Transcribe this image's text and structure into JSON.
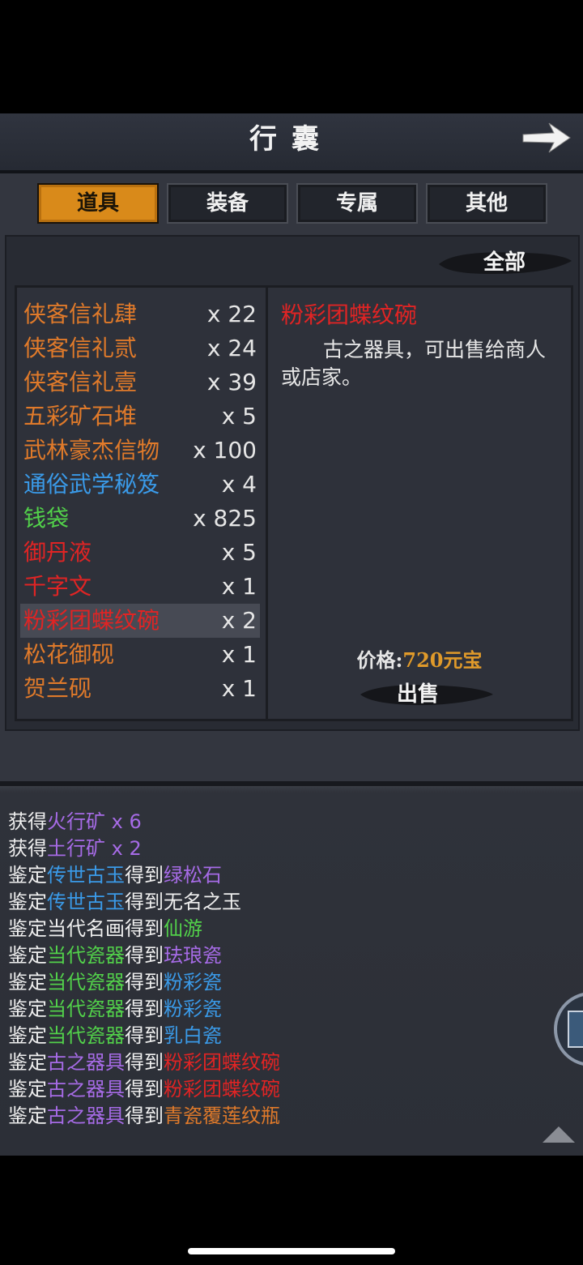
{
  "header": {
    "title": "行囊",
    "back_icon": "right-arrow-icon"
  },
  "tabs": [
    {
      "label": "道具",
      "active": true
    },
    {
      "label": "装备",
      "active": false
    },
    {
      "label": "专属",
      "active": false
    },
    {
      "label": "其他",
      "active": false
    }
  ],
  "filter": {
    "label": "全部"
  },
  "items": [
    {
      "name": "侠客信礼肆",
      "qty": "x 22",
      "color": "#e07a2a"
    },
    {
      "name": "侠客信礼贰",
      "qty": "x 24",
      "color": "#e07a2a"
    },
    {
      "name": "侠客信礼壹",
      "qty": "x 39",
      "color": "#e07a2a"
    },
    {
      "name": "五彩矿石堆",
      "qty": "x 5",
      "color": "#e07a2a"
    },
    {
      "name": "武林豪杰信物",
      "qty": "x 100",
      "color": "#e07a2a"
    },
    {
      "name": "通俗武学秘笈",
      "qty": "x 4",
      "color": "#3a9ae8"
    },
    {
      "name": "钱袋",
      "qty": "x 825",
      "color": "#52d14a"
    },
    {
      "name": "御丹液",
      "qty": "x 5",
      "color": "#e02424"
    },
    {
      "name": "千字文",
      "qty": "x 1",
      "color": "#e02424"
    },
    {
      "name": "粉彩团蝶纹碗",
      "qty": "x 2",
      "color": "#e02424",
      "selected": true
    },
    {
      "name": "松花御砚",
      "qty": "x 1",
      "color": "#e07a2a"
    },
    {
      "name": "贺兰砚",
      "qty": "x 1",
      "color": "#e07a2a"
    }
  ],
  "detail": {
    "name": "粉彩团蝶纹碗",
    "description": "古之器具，可出售给商人或店家。",
    "price_label": "价格:",
    "price_value": "720元宝",
    "sell_label": "出售"
  },
  "colors": {
    "orange": "#e07a2a",
    "blue": "#3a9ae8",
    "green": "#52d14a",
    "red": "#e02424",
    "purple": "#a66be6",
    "white": "#efefef"
  },
  "log": [
    [
      {
        "t": "获得",
        "c": "white"
      },
      {
        "t": "火行矿 x 6",
        "c": "purple"
      }
    ],
    [
      {
        "t": "获得",
        "c": "white"
      },
      {
        "t": "土行矿 x 2",
        "c": "purple"
      }
    ],
    [
      {
        "t": "鉴定",
        "c": "white"
      },
      {
        "t": "传世古玉",
        "c": "blue"
      },
      {
        "t": "得到",
        "c": "white"
      },
      {
        "t": "绿松石",
        "c": "purple"
      }
    ],
    [
      {
        "t": "鉴定",
        "c": "white"
      },
      {
        "t": "传世古玉",
        "c": "blue"
      },
      {
        "t": "得到无名之玉",
        "c": "white"
      }
    ],
    [
      {
        "t": "鉴定当代名画得到",
        "c": "white"
      },
      {
        "t": "仙游",
        "c": "green"
      }
    ],
    [
      {
        "t": "鉴定",
        "c": "white"
      },
      {
        "t": "当代瓷器",
        "c": "green"
      },
      {
        "t": "得到",
        "c": "white"
      },
      {
        "t": "珐琅瓷",
        "c": "purple"
      }
    ],
    [
      {
        "t": "鉴定",
        "c": "white"
      },
      {
        "t": "当代瓷器",
        "c": "green"
      },
      {
        "t": "得到",
        "c": "white"
      },
      {
        "t": "粉彩瓷",
        "c": "blue"
      }
    ],
    [
      {
        "t": "鉴定",
        "c": "white"
      },
      {
        "t": "当代瓷器",
        "c": "green"
      },
      {
        "t": "得到",
        "c": "white"
      },
      {
        "t": "粉彩瓷",
        "c": "blue"
      }
    ],
    [
      {
        "t": "鉴定",
        "c": "white"
      },
      {
        "t": "当代瓷器",
        "c": "green"
      },
      {
        "t": "得到",
        "c": "white"
      },
      {
        "t": "乳白瓷",
        "c": "blue"
      }
    ],
    [
      {
        "t": "鉴定",
        "c": "white"
      },
      {
        "t": "古之器具",
        "c": "purple"
      },
      {
        "t": "得到",
        "c": "white"
      },
      {
        "t": "粉彩团蝶纹碗",
        "c": "red"
      }
    ],
    [
      {
        "t": "鉴定",
        "c": "white"
      },
      {
        "t": "古之器具",
        "c": "purple"
      },
      {
        "t": "得到",
        "c": "white"
      },
      {
        "t": "粉彩团蝶纹碗",
        "c": "red"
      }
    ],
    [
      {
        "t": "鉴定",
        "c": "white"
      },
      {
        "t": "古之器具",
        "c": "purple"
      },
      {
        "t": "得到",
        "c": "white"
      },
      {
        "t": "青瓷覆莲纹瓶",
        "c": "orange"
      }
    ]
  ]
}
